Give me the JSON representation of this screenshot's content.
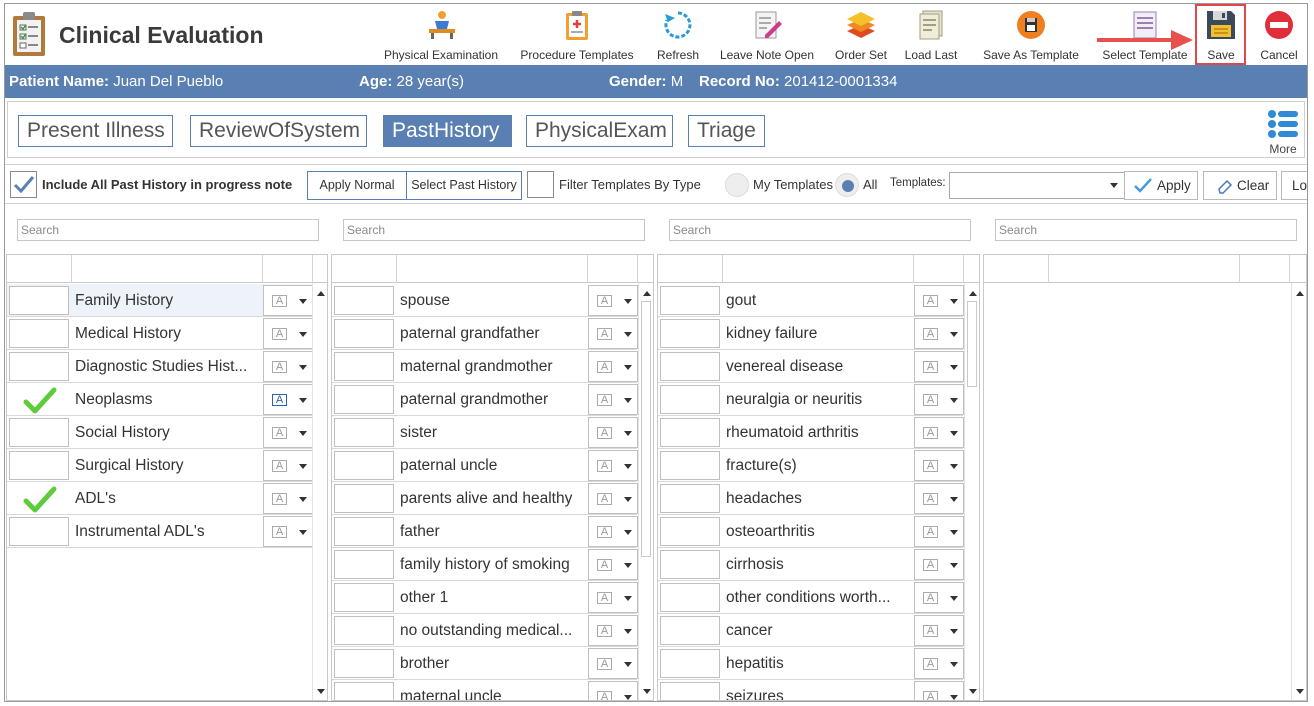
{
  "app": {
    "title": "Clinical Evaluation"
  },
  "toolbar": {
    "buttons": [
      {
        "label": "Physical Examination",
        "icon": "physical-exam-icon"
      },
      {
        "label": "Procedure Templates",
        "icon": "clipboard-icon"
      },
      {
        "label": "Refresh",
        "icon": "refresh-icon"
      },
      {
        "label": "Leave Note Open",
        "icon": "edit-note-icon"
      },
      {
        "label": "Order Set",
        "icon": "layers-icon"
      },
      {
        "label": "Load Last",
        "icon": "document-icon"
      },
      {
        "label": "Save As Template",
        "icon": "save-template-icon"
      },
      {
        "label": "Select Template",
        "icon": "template-list-icon"
      },
      {
        "label": "Save",
        "icon": "floppy-disk-icon"
      },
      {
        "label": "Cancel",
        "icon": "cancel-icon"
      }
    ]
  },
  "patient": {
    "name_label": "Patient Name:",
    "name_value": "Juan Del Pueblo",
    "age_label": "Age:",
    "age_value": "28 year(s)",
    "gender_label": "Gender:",
    "gender_value": "M",
    "record_label": "Record No:",
    "record_value": "201412-0001334"
  },
  "tabs": [
    {
      "label": "Present Illness",
      "active": false
    },
    {
      "label": "ReviewOfSystem",
      "active": false
    },
    {
      "label": "PastHistory",
      "active": true
    },
    {
      "label": "PhysicalExam",
      "active": false
    },
    {
      "label": "Triage",
      "active": false
    }
  ],
  "more_label": "More",
  "options": {
    "include_label": "Include All Past History in progress note",
    "include_checked": true,
    "apply_normal": "Apply Normal",
    "select_past_history": "Select Past History",
    "filter_label": "Filter Templates By Type",
    "my_templates": "My Templates",
    "all": "All",
    "templates_label": "Templates:",
    "templates_value": "",
    "apply": "Apply",
    "clear": "Clear",
    "load": "Lo"
  },
  "search_placeholder": "Search",
  "grid1": {
    "rows": [
      {
        "label": "Family History",
        "checked": false,
        "selected": true
      },
      {
        "label": "Medical History",
        "checked": false
      },
      {
        "label": "Diagnostic Studies Hist...",
        "checked": false
      },
      {
        "label": "Neoplasms",
        "checked": true
      },
      {
        "label": "Social History",
        "checked": false
      },
      {
        "label": "Surgical History",
        "checked": false
      },
      {
        "label": "ADL's",
        "checked": true
      },
      {
        "label": "Instrumental ADL's",
        "checked": false
      }
    ]
  },
  "grid2": {
    "rows": [
      "spouse",
      "paternal grandfather",
      "maternal grandmother",
      "paternal grandmother",
      "sister",
      "paternal uncle",
      "parents alive and healthy",
      "father",
      "family history of smoking",
      "other 1",
      "no outstanding medical...",
      "brother",
      "maternal uncle"
    ]
  },
  "grid3": {
    "rows": [
      "gout",
      "kidney failure",
      "venereal disease",
      "neuralgia or neuritis",
      "rheumatoid arthritis",
      "fracture(s)",
      "headaches",
      "osteoarthritis",
      "cirrhosis",
      "other conditions worth...",
      "cancer",
      "hepatitis",
      "seizures"
    ]
  },
  "colors": {
    "accent": "#5a7fb2",
    "highlight": "#e0464a",
    "check": "#5ecb3c"
  }
}
